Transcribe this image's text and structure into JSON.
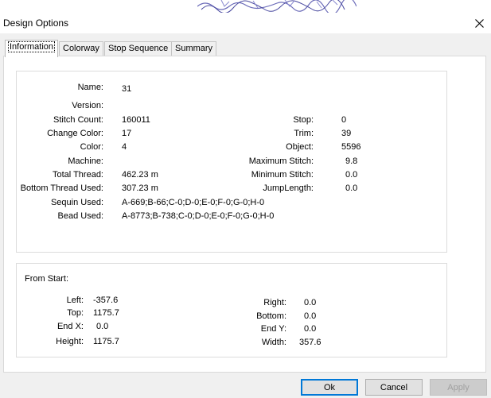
{
  "window": {
    "title": "Design Options"
  },
  "tabs": [
    "Information",
    "Colorway",
    "Stop Sequence",
    "Summary"
  ],
  "info": {
    "name_label": "Name:",
    "name_value": "31",
    "version_label": "Version:",
    "version_value": "",
    "stitch_count_label": "Stitch Count:",
    "stitch_count_value": "160011",
    "change_color_label": "Change Color:",
    "change_color_value": "17",
    "color_label": "Color:",
    "color_value": "4",
    "machine_label": "Machine:",
    "machine_value": "",
    "total_thread_label": "Total Thread:",
    "total_thread_value": "462.23 m",
    "bottom_thread_label": "Bottom Thread Used:",
    "bottom_thread_value": "307.23 m",
    "sequin_label": "Sequin Used:",
    "sequin_value": "A-669;B-66;C-0;D-0;E-0;F-0;G-0;H-0",
    "bead_label": "Bead Used:",
    "bead_value": "A-8773;B-738;C-0;D-0;E-0;F-0;G-0;H-0",
    "stop_label": "Stop:",
    "stop_value": "0",
    "trim_label": "Trim:",
    "trim_value": "39",
    "object_label": "Object:",
    "object_value": "5596",
    "max_stitch_label": "Maximum Stitch:",
    "max_stitch_value": "9.8",
    "min_stitch_label": "Minimum Stitch:",
    "min_stitch_value": "0.0",
    "jump_length_label": "JumpLength:",
    "jump_length_value": "0.0"
  },
  "from_start": {
    "title": "From Start:",
    "left_label": "Left:",
    "left_value": "-357.6",
    "top_label": "Top:",
    "top_value": "1175.7",
    "end_x_label": "End X:",
    "end_x_value": "0.0",
    "height_label": "Height:",
    "height_value": "1175.7",
    "right_label": "Right:",
    "right_value": "0.0",
    "bottom_label": "Bottom:",
    "bottom_value": "0.0",
    "end_y_label": "End Y:",
    "end_y_value": "0.0",
    "width_label": "Width:",
    "width_value": "357.6"
  },
  "buttons": {
    "ok": "Ok",
    "cancel": "Cancel",
    "apply": "Apply"
  }
}
